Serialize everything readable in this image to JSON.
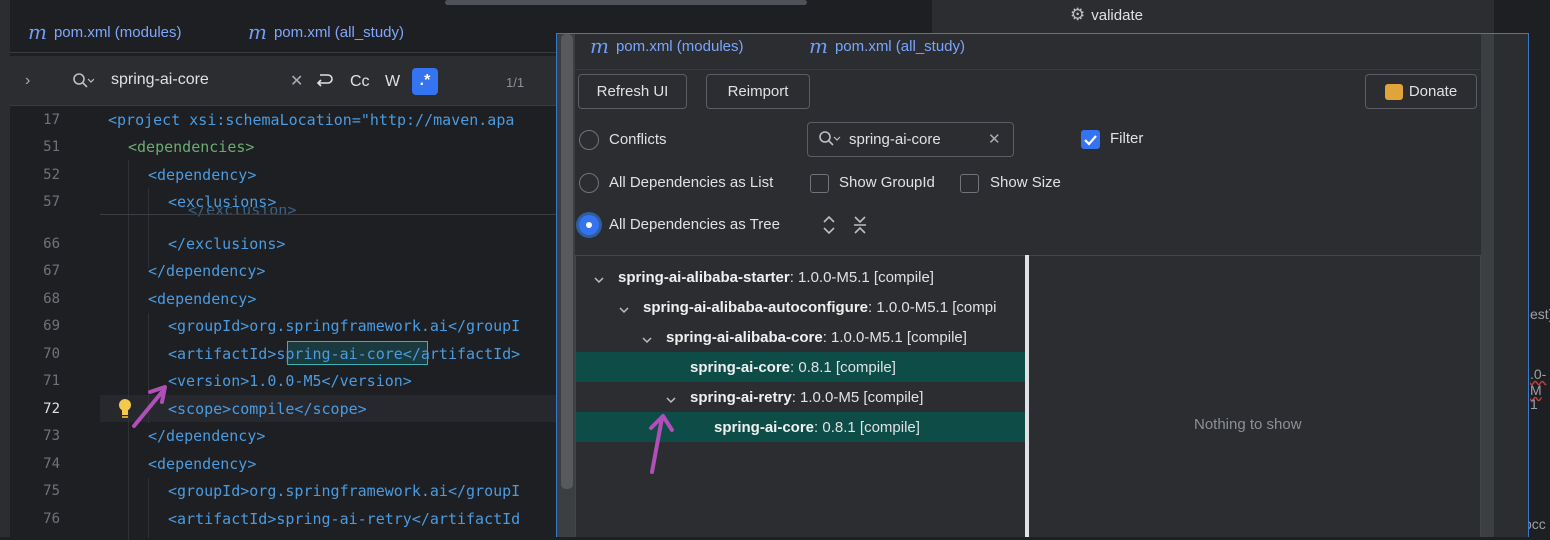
{
  "editor": {
    "tabs": [
      {
        "icon": "m",
        "label": "pom.xml (modules)"
      },
      {
        "icon": "m",
        "label": "pom.xml (all_study)"
      }
    ],
    "find": {
      "query": "spring-ai-core",
      "match_case_label": "Cc",
      "words_label": "W",
      "regex_label": ".*",
      "result_count": "1/1"
    },
    "lines": [
      {
        "num": "17",
        "code": "<project xsi:schemaLocation=\"http://maven.apa"
      },
      {
        "num": "51",
        "code": "<dependencies>"
      },
      {
        "num": "52",
        "code": "<dependency>"
      },
      {
        "num": "57",
        "code": "<exclusions>"
      },
      {
        "num": "66",
        "code": "</exclusions>"
      },
      {
        "num": "67",
        "code": "</dependency>"
      },
      {
        "num": "68",
        "code": "<dependency>"
      },
      {
        "num": "69",
        "code": "<groupId>org.springframework.ai</groupI"
      },
      {
        "num": "70",
        "code": "<artifactId>spring-ai-core</artifactId>"
      },
      {
        "num": "71",
        "code": "<version>1.0.0-M5</version>"
      },
      {
        "num": "72",
        "code": "<scope>compile</scope>"
      },
      {
        "num": "73",
        "code": "</dependency>"
      },
      {
        "num": "74",
        "code": "<dependency>"
      },
      {
        "num": "75",
        "code": "<groupId>org.springframework.ai</groupI"
      },
      {
        "num": "76",
        "code": "<artifactId>spring-ai-retry</artifactId"
      }
    ],
    "folded_fragment": "</exclusion>",
    "highlight_text": "spring-ai-core"
  },
  "panel": {
    "tabs": [
      {
        "icon": "m",
        "label": "pom.xml (modules)"
      },
      {
        "icon": "m",
        "label": "pom.xml (all_study)"
      }
    ],
    "buttons": {
      "refresh": "Refresh UI",
      "reimport": "Reimport",
      "donate": "Donate"
    },
    "options": {
      "conflicts": "Conflicts",
      "as_list": "All Dependencies as List",
      "as_tree": "All Dependencies as Tree",
      "show_group": "Show GroupId",
      "show_size": "Show Size",
      "filter": "Filter"
    },
    "search": {
      "value": "spring-ai-core"
    },
    "tree": [
      {
        "name": "spring-ai-alibaba-starter",
        "ver": " : 1.0.0-M5.1 [compile]"
      },
      {
        "name": "spring-ai-alibaba-autoconfigure",
        "ver": " : 1.0.0-M5.1 [compi"
      },
      {
        "name": "spring-ai-alibaba-core",
        "ver": " : 1.0.0-M5.1 [compile]"
      },
      {
        "name": "spring-ai-core",
        "ver": " : 0.8.1 [compile]"
      },
      {
        "name": "spring-ai-retry",
        "ver": " : 1.0.0-M5 [compile]"
      },
      {
        "name": "spring-ai-core",
        "ver": " : 0.8.1 [compile]"
      }
    ],
    "detail_empty": "Nothing to show"
  },
  "topright": {
    "validate_label": "validate"
  },
  "right_strip": {
    "fragments": [
      "est)",
      ".0-M",
      "1",
      "occ"
    ]
  },
  "colors": {
    "accent": "#3574f0",
    "selection": "#0e4c48",
    "arrow": "#b04fb8"
  }
}
